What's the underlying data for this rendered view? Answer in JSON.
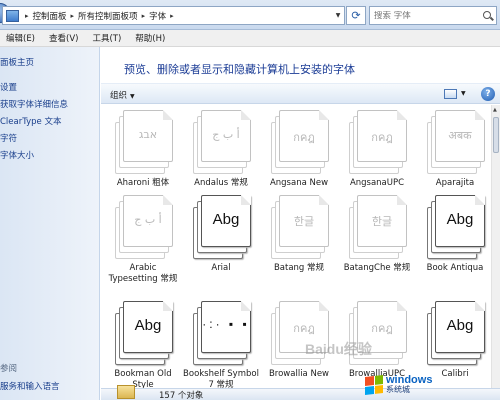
{
  "address_bar": {
    "breadcrumbs": [
      "控制面板",
      "所有控制面板项",
      "字体"
    ],
    "search_placeholder": "搜索 字体"
  },
  "menu": [
    "编辑(E)",
    "查看(V)",
    "工具(T)",
    "帮助(H)"
  ],
  "left_pane": {
    "links": [
      "面板主页",
      "设置",
      "获取字体详细信息",
      "ClearType 文本",
      "字符",
      "字体大小"
    ],
    "see_also_heading": "参阅",
    "see_also_links": [
      "服务和输入语言"
    ]
  },
  "content": {
    "title": "预览、删除或者显示和隐藏计算机上安装的字体",
    "organize_label": "组织",
    "status_count": "157 个对象"
  },
  "fonts": [
    {
      "name": "Aharoni 粗体",
      "sample": "אבג",
      "style": "faded"
    },
    {
      "name": "Andalus 常规",
      "sample": "أ ب ج",
      "style": "faded"
    },
    {
      "name": "Angsana New",
      "sample": "กคฎ",
      "style": "faded"
    },
    {
      "name": "AngsanaUPC",
      "sample": "กคฎ",
      "style": "faded"
    },
    {
      "name": "Aparajita",
      "sample": "अबक",
      "style": "faded"
    },
    {
      "name": "Arabic Typesetting 常规",
      "sample": "أ ب ج",
      "style": "faded"
    },
    {
      "name": "Arial",
      "sample": "Abg",
      "style": "dark"
    },
    {
      "name": "Batang 常规",
      "sample": "한글",
      "style": "faded"
    },
    {
      "name": "BatangChe 常规",
      "sample": "한글",
      "style": "faded"
    },
    {
      "name": "Book Antiqua",
      "sample": "Abg",
      "style": "dark"
    },
    {
      "name": "Bookman Old Style",
      "sample": "Abg",
      "style": "dark"
    },
    {
      "name": "Bookshelf Symbol 7 常规",
      "sample": "·:· ▪ ▪",
      "style": "symbol"
    },
    {
      "name": "Browallia New",
      "sample": "กคฎ",
      "style": "faded"
    },
    {
      "name": "BrowalliaUPC",
      "sample": "กคฎ",
      "style": "faded"
    },
    {
      "name": "Calibri",
      "sample": "Abg",
      "style": "dark"
    }
  ],
  "watermarks": {
    "baidu": "Baidu经验",
    "windows_brand": "windows",
    "windows_site": "系统城"
  }
}
